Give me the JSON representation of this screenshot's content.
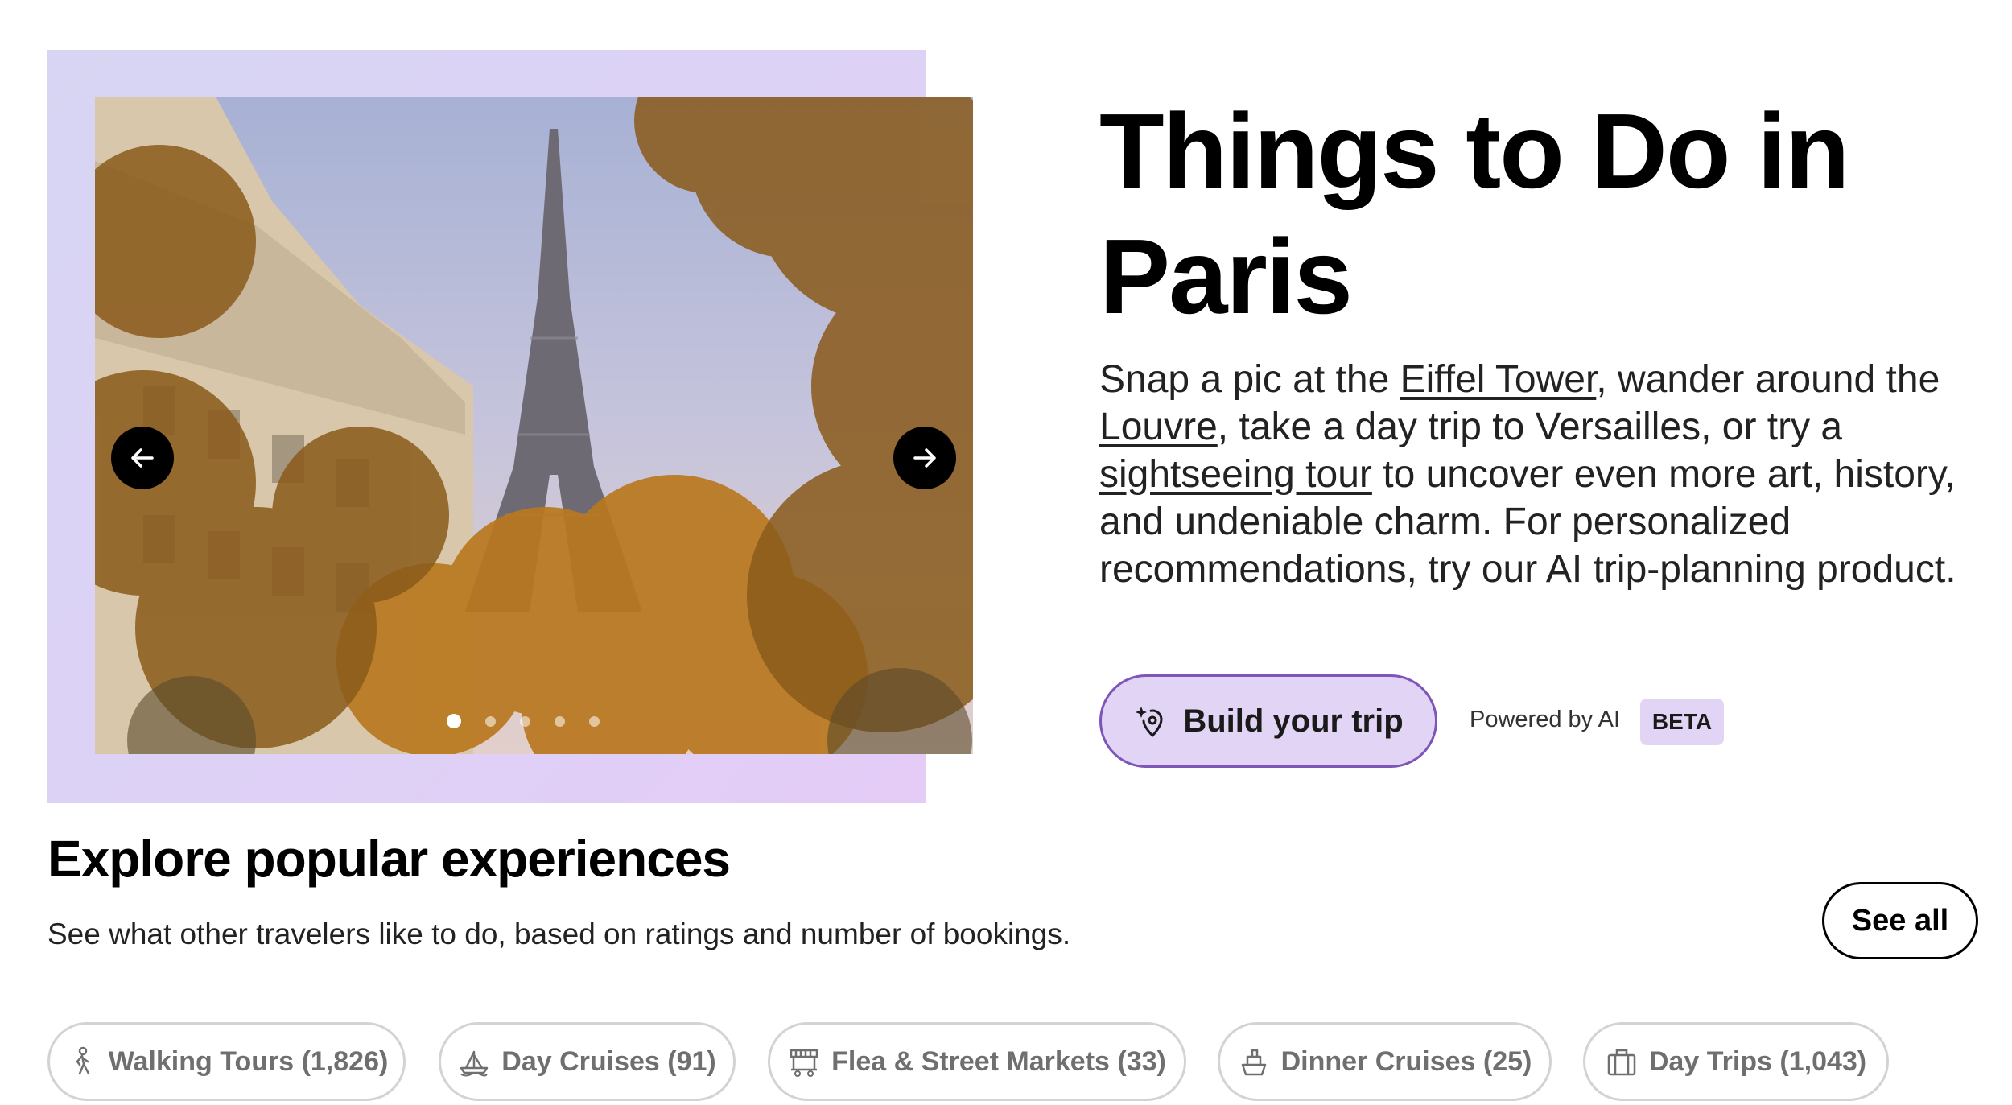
{
  "hero": {
    "title": "Things to Do in Paris",
    "description": {
      "t1": "Snap a pic at the ",
      "link1": "Eiffel Tower",
      "t2": ", wander around the ",
      "link2": "Louvre",
      "t3": ", take a day trip to Versailles, or try a ",
      "link3": "sightseeing tour",
      "t4": " to uncover even more art, history, and undeniable charm. For personalized recommendations, try our AI trip-planning product."
    },
    "build_button_label": "Build your trip",
    "powered_label": "Powered by AI",
    "beta_badge": "BETA",
    "carousel": {
      "slide_count": 5,
      "active_index": 0,
      "prev_icon": "arrow-left-icon",
      "next_icon": "arrow-right-icon"
    }
  },
  "explore": {
    "title": "Explore popular experiences",
    "subtitle": "See what other travelers like to do, based on ratings and number of bookings.",
    "see_all_label": "See all",
    "chips": [
      {
        "label": "Walking Tours (1,826)",
        "icon": "walking-person-icon"
      },
      {
        "label": "Day Cruises (91)",
        "icon": "boat-icon"
      },
      {
        "label": "Flea & Street Markets (33)",
        "icon": "market-stall-icon"
      },
      {
        "label": "Dinner Cruises (25)",
        "icon": "ship-icon"
      },
      {
        "label": "Day Trips (1,043)",
        "icon": "suitcase-icon"
      }
    ]
  },
  "colors": {
    "accent": "#e2d4f5",
    "accent_border": "#7e55b8",
    "hero_bg": "#dcd2f6"
  }
}
